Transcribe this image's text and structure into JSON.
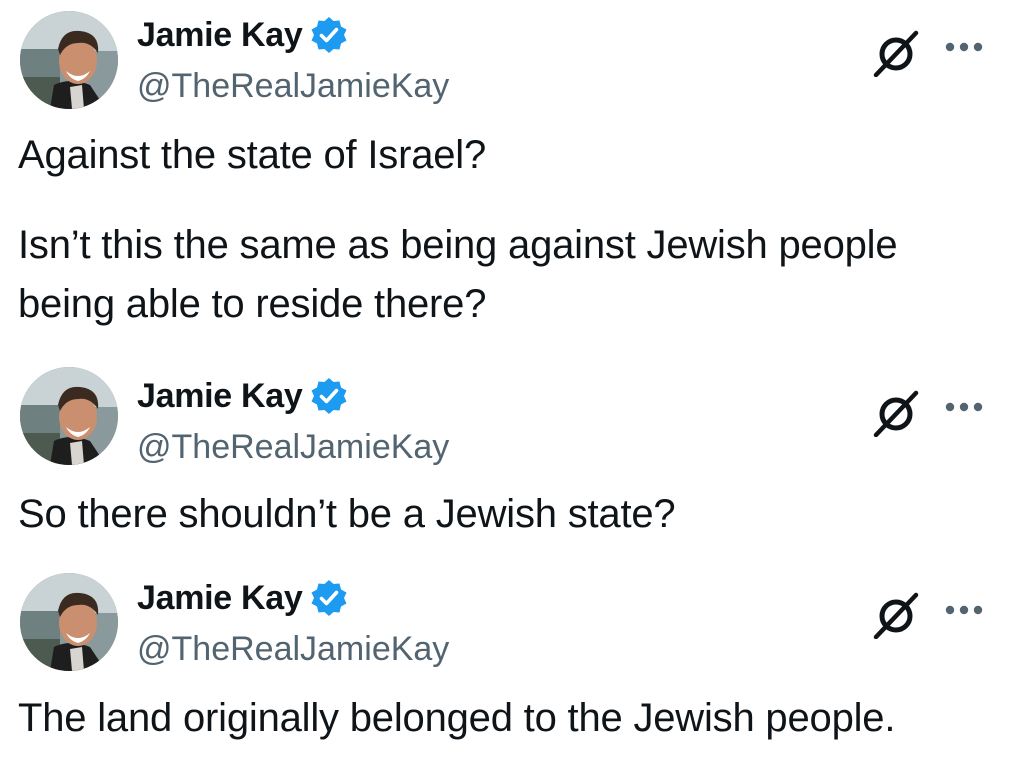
{
  "tweets": [
    {
      "author": {
        "name": "Jamie Kay",
        "handle": "@TheRealJamieKay",
        "verified": true
      },
      "paragraphs": [
        "Against the state of Israel?",
        "Isn’t this the same as being against Jewish people being able to reside there?"
      ]
    },
    {
      "author": {
        "name": "Jamie Kay",
        "handle": "@TheRealJamieKay",
        "verified": true
      },
      "paragraphs": [
        "So there shouldn’t be a Jewish state?"
      ]
    },
    {
      "author": {
        "name": "Jamie Kay",
        "handle": "@TheRealJamieKay",
        "verified": true
      },
      "paragraphs": [
        "The land originally belonged to the Jewish people."
      ]
    }
  ],
  "colors": {
    "verified_badge": "#1d9bf0",
    "handle_text": "#536471",
    "body_text": "#0f1419"
  },
  "icons": {
    "verified": "verified-badge-icon",
    "grok": "grok-icon",
    "more": "more-options-icon"
  }
}
